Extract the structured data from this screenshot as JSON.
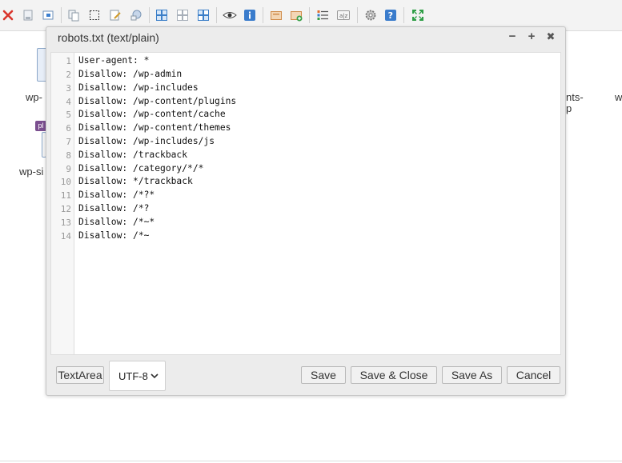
{
  "toolbar": {
    "icons": [
      "close-icon",
      "delete-icon",
      "preview-icon",
      "copy-icon",
      "select-icon",
      "edit-icon",
      "share-icon",
      "view-large-icon",
      "view-grid-icon",
      "view-list-icon",
      "eye-icon",
      "info-icon",
      "folder-icon",
      "folder-add-icon",
      "details-icon",
      "sort-icon",
      "gear-icon",
      "help-icon",
      "fullscreen-icon"
    ]
  },
  "background": {
    "labels": [
      "wp-",
      "wp-si",
      "nts-",
      "p",
      "w"
    ],
    "file_badge": "pl"
  },
  "dialog": {
    "title": "robots.txt (text/plain)",
    "controls": {
      "minimize": "−",
      "maximize": "+",
      "close": "✖"
    },
    "lines": [
      {
        "n": "1",
        "text": "User-agent: *"
      },
      {
        "n": "2",
        "text": "Disallow: /wp-admin"
      },
      {
        "n": "3",
        "text": "Disallow: /wp-includes"
      },
      {
        "n": "4",
        "text": "Disallow: /wp-content/plugins"
      },
      {
        "n": "5",
        "text": "Disallow: /wp-content/cache"
      },
      {
        "n": "6",
        "text": "Disallow: /wp-content/themes"
      },
      {
        "n": "7",
        "text": "Disallow: /wp-includes/js"
      },
      {
        "n": "8",
        "text": "Disallow: /trackback"
      },
      {
        "n": "9",
        "text": "Disallow: /category/*/*"
      },
      {
        "n": "10",
        "text": "Disallow: */trackback"
      },
      {
        "n": "11",
        "text": "Disallow: /*?*"
      },
      {
        "n": "12",
        "text": "Disallow: /*?"
      },
      {
        "n": "13",
        "text": "Disallow: /*~*"
      },
      {
        "n": "14",
        "text": "Disallow: /*~"
      }
    ],
    "footer": {
      "textarea_label": "TextArea",
      "encoding": "UTF-8",
      "save": "Save",
      "save_close": "Save & Close",
      "save_as": "Save As",
      "cancel": "Cancel"
    }
  }
}
